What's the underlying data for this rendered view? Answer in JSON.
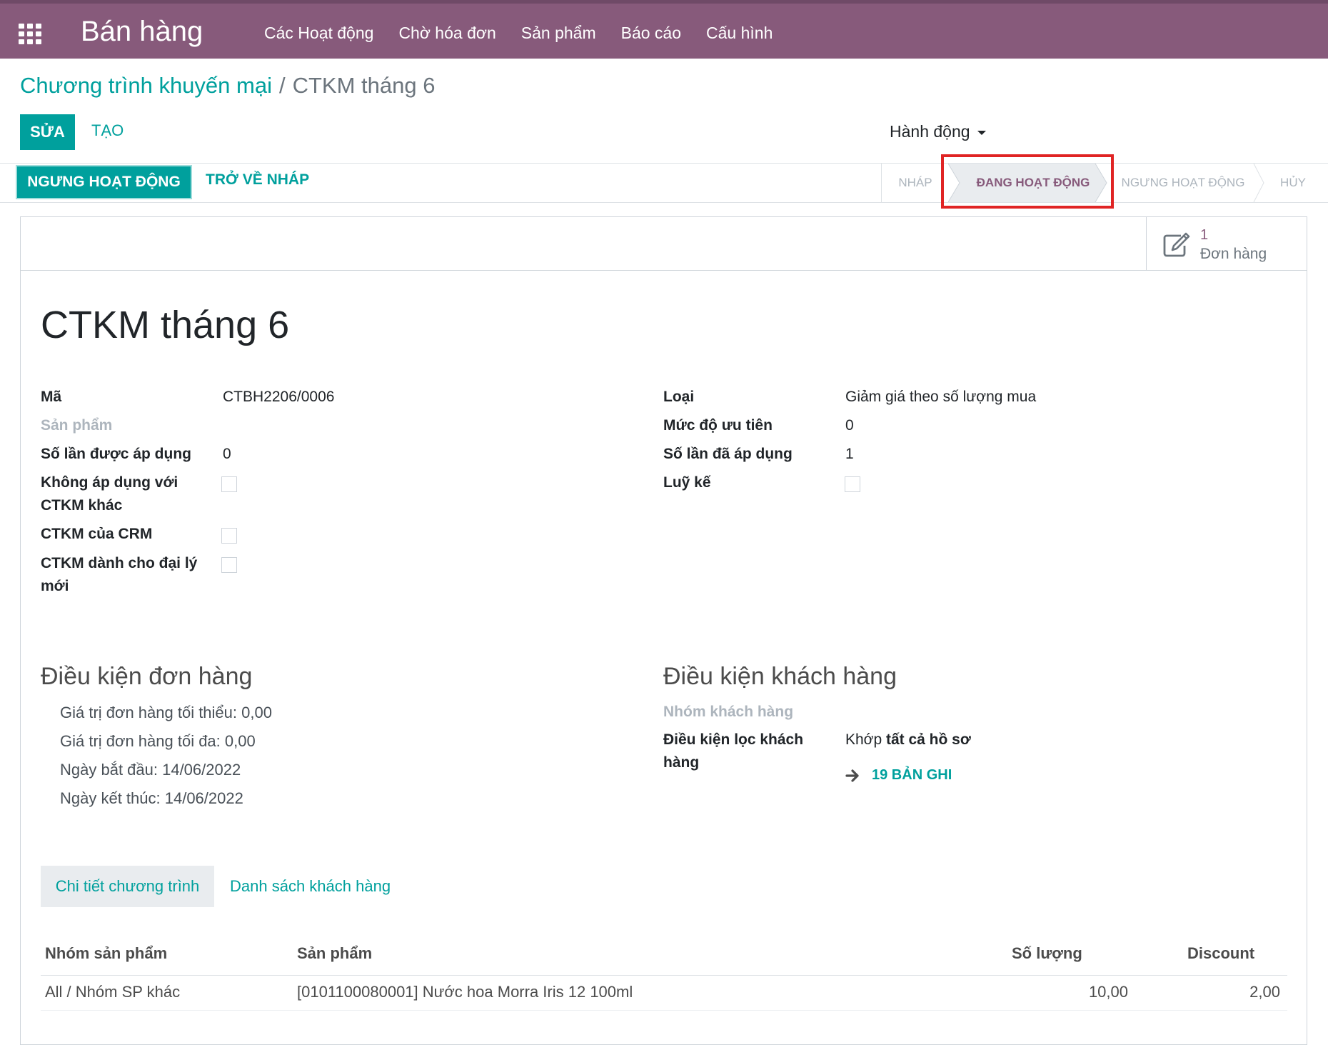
{
  "app": {
    "name": "Bán hàng"
  },
  "menu": [
    "Các Hoạt động",
    "Chờ hóa đơn",
    "Sản phẩm",
    "Báo cáo",
    "Cấu hình"
  ],
  "breadcrumb": {
    "parent": "Chương trình khuyến mại",
    "separator": "/",
    "current": "CTKM tháng 6"
  },
  "toolbar": {
    "edit": "SỬA",
    "create": "TẠO",
    "actions": "Hành động"
  },
  "statusbar": {
    "stop_button": "NGƯNG HOẠT ĐỘNG",
    "draft_button": "TRỞ VỀ NHÁP",
    "stages": [
      "NHÁP",
      "ĐANG HOẠT ĐỘNG",
      "NGƯNG HOẠT ĐỘNG",
      "HỦY"
    ],
    "active_stage": "ĐANG HOẠT ĐỘNG"
  },
  "smart_button": {
    "value": "1",
    "label": "Đơn hàng"
  },
  "record": {
    "title": "CTKM tháng 6",
    "left": {
      "code_label": "Mã",
      "code_value": "CTBH2206/0006",
      "product_label": "Sản phẩm",
      "applicable_times_label": "Số lần được áp dụng",
      "applicable_times_value": "0",
      "not_combine_label": "Không áp dụng với CTKM khác",
      "crm_label": "CTKM của CRM",
      "new_agent_label": "CTKM dành cho đại lý mới"
    },
    "right": {
      "type_label": "Loại",
      "type_value": "Giảm giá theo số lượng mua",
      "priority_label": "Mức độ ưu tiên",
      "priority_value": "0",
      "applied_label": "Số lần đã áp dụng",
      "applied_value": "1",
      "cumulative_label": "Luỹ kế"
    }
  },
  "order_conditions": {
    "heading": "Điều kiện đơn hàng",
    "min_value": "Giá trị đơn hàng tối thiểu:  0,00",
    "max_value": "Giá trị đơn hàng tối đa:  0,00",
    "start_date": "Ngày bắt đầu:  14/06/2022",
    "end_date": "Ngày kết thúc:  14/06/2022"
  },
  "customer_conditions": {
    "heading": "Điều kiện khách hàng",
    "group_label": "Nhóm khách hàng",
    "filter_label": "Điều kiện lọc khách hàng",
    "filter_prefix": "Khớp ",
    "filter_bold": "tất cả hồ sơ",
    "records_link": "19 BẢN GHI"
  },
  "tabs": [
    "Chi tiết chương trình",
    "Danh sách khách hàng"
  ],
  "table": {
    "headers": [
      "Nhóm sản phẩm",
      "Sản phẩm",
      "Số lượng",
      "Discount"
    ],
    "rows": [
      [
        "All / Nhóm SP khác",
        "[0101100080001] Nước hoa Morra Iris 12 100ml",
        "10,00",
        "2,00"
      ]
    ]
  },
  "colors": {
    "brand": "#875a7b",
    "accent": "#00a09d",
    "highlight": "#e02424"
  }
}
